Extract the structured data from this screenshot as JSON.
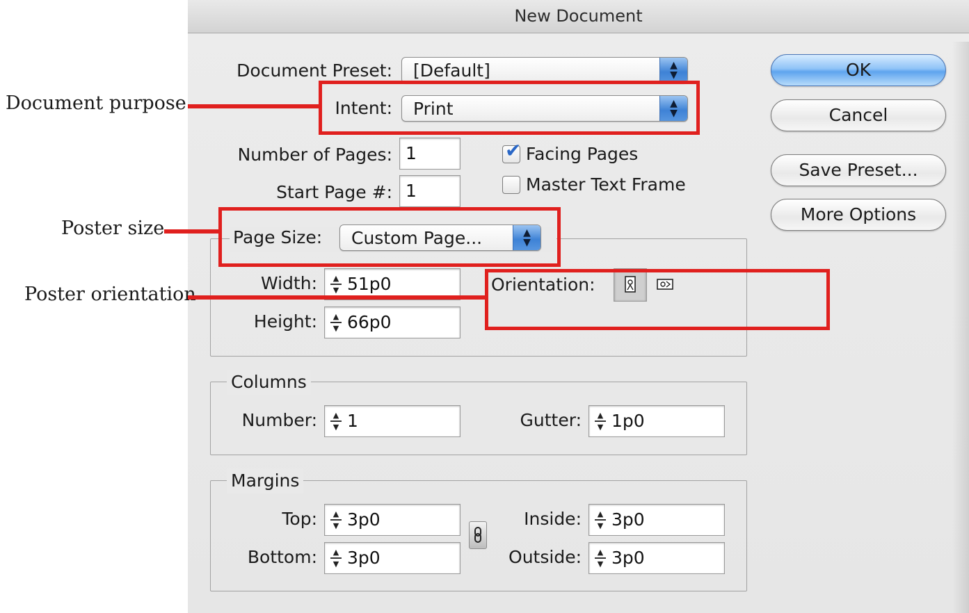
{
  "window": {
    "title": "New Document"
  },
  "preset": {
    "label": "Document Preset:",
    "value": "[Default]"
  },
  "intent": {
    "label": "Intent:",
    "value": "Print"
  },
  "pages": {
    "count_label": "Number of Pages:",
    "count_value": "1",
    "start_label": "Start Page #:",
    "start_value": "1"
  },
  "options": {
    "facing_pages": {
      "label": "Facing Pages",
      "checked": true
    },
    "master_text_frame": {
      "label": "Master Text Frame",
      "checked": false
    }
  },
  "page_size": {
    "label": "Page Size:",
    "value": "Custom Page...",
    "width_label": "Width:",
    "width_value": "51p0",
    "height_label": "Height:",
    "height_value": "66p0",
    "orientation_label": "Orientation:",
    "orientation_selected": "portrait"
  },
  "columns": {
    "title": "Columns",
    "number_label": "Number:",
    "number_value": "1",
    "gutter_label": "Gutter:",
    "gutter_value": "1p0"
  },
  "margins": {
    "title": "Margins",
    "top_label": "Top:",
    "top_value": "3p0",
    "bottom_label": "Bottom:",
    "bottom_value": "3p0",
    "inside_label": "Inside:",
    "inside_value": "3p0",
    "outside_label": "Outside:",
    "outside_value": "3p0",
    "link_icon": "chain-link-icon"
  },
  "buttons": {
    "ok": "OK",
    "cancel": "Cancel",
    "save_preset": "Save Preset...",
    "more_options": "More Options"
  },
  "annotations": {
    "document_purpose": "Document purpose",
    "poster_size": "Poster size",
    "poster_orientation": "Poster orientation",
    "color": "#e0201e"
  }
}
